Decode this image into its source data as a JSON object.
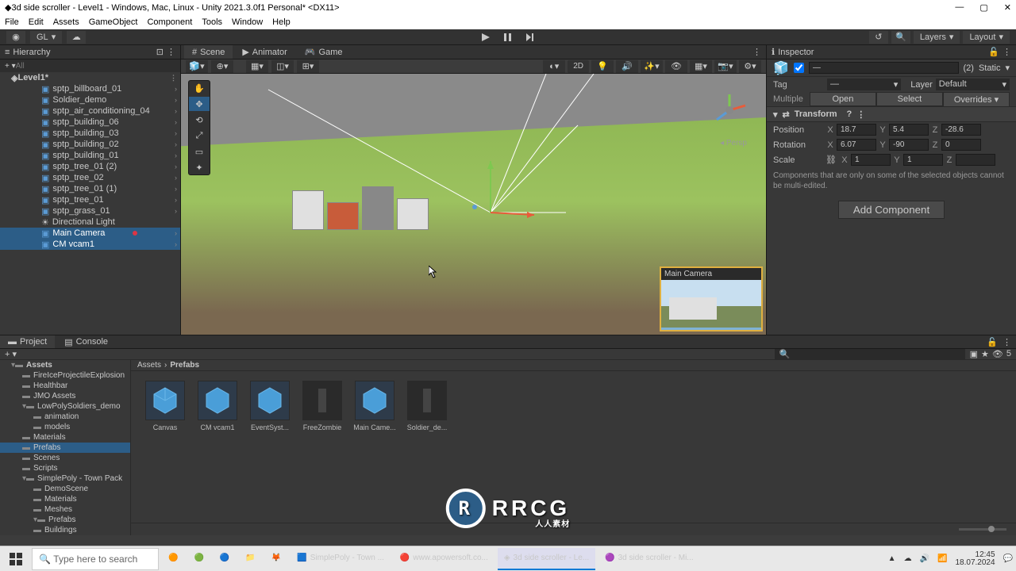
{
  "window": {
    "title": "3d side scroller - Level1 - Windows, Mac, Linux - Unity 2021.3.0f1 Personal* <DX11>",
    "min": "—",
    "max": "▢",
    "close": "✕"
  },
  "menu": [
    "File",
    "Edit",
    "Assets",
    "GameObject",
    "Component",
    "Tools",
    "Window",
    "Help"
  ],
  "toolbar": {
    "gl": "GL",
    "layers": "Layers",
    "layout": "Layout"
  },
  "hierarchy": {
    "title": "Hierarchy",
    "search_placeholder": "All",
    "scene": "Level1*",
    "items": [
      "sptp_billboard_01",
      "Soldier_demo",
      "sptp_air_conditioning_04",
      "sptp_building_06",
      "sptp_building_03",
      "sptp_building_02",
      "sptp_building_01",
      "sptp_tree_01 (2)",
      "sptp_tree_02",
      "sptp_tree_01 (1)",
      "sptp_tree_01",
      "sptp_grass_01",
      "Directional Light",
      "Main Camera",
      "CM vcam1"
    ],
    "selected_indices": [
      13,
      14
    ],
    "red_dot_index": 13
  },
  "scene_tabs": {
    "scene": "Scene",
    "animator": "Animator",
    "game": "Game"
  },
  "scene_toolbar": {
    "mode_2d": "2D",
    "persp": "Persp"
  },
  "camera_preview": {
    "label": "Main Camera"
  },
  "inspector": {
    "title": "Inspector",
    "count": "(2)",
    "static": "Static",
    "tag_label": "Tag",
    "tag_value": "—",
    "layer_label": "Layer",
    "layer_value": "Default",
    "multiple": "Multiple",
    "open": "Open",
    "select": "Select",
    "overrides": "Overrides",
    "transform": "Transform",
    "position": "Position",
    "rotation": "Rotation",
    "scale": "Scale",
    "pos": {
      "x": "18.7",
      "y": "5.4",
      "z": "-28.6"
    },
    "rot": {
      "x": "6.07",
      "y": "-90",
      "z": "0"
    },
    "scl": {
      "x": "1",
      "y": "1",
      "z": ""
    },
    "multi_info": "Components that are only on some of the selected objects cannot be multi-edited.",
    "add_component": "Add Component"
  },
  "project": {
    "project_tab": "Project",
    "console_tab": "Console",
    "tree": [
      {
        "label": "Assets",
        "level": 0,
        "expanded": true
      },
      {
        "label": "FireIceProjectileExplosion",
        "level": 1
      },
      {
        "label": "Healthbar",
        "level": 1
      },
      {
        "label": "JMO Assets",
        "level": 1
      },
      {
        "label": "LowPolySoldiers_demo",
        "level": 1,
        "expanded": true
      },
      {
        "label": "animation",
        "level": 2
      },
      {
        "label": "models",
        "level": 2
      },
      {
        "label": "Materials",
        "level": 1
      },
      {
        "label": "Prefabs",
        "level": 1,
        "selected": true
      },
      {
        "label": "Scenes",
        "level": 1
      },
      {
        "label": "Scripts",
        "level": 1
      },
      {
        "label": "SimplePoly - Town Pack",
        "level": 1,
        "expanded": true
      },
      {
        "label": "DemoScene",
        "level": 2
      },
      {
        "label": "Materials",
        "level": 2
      },
      {
        "label": "Meshes",
        "level": 2
      },
      {
        "label": "Prefabs",
        "level": 2,
        "expanded": true
      },
      {
        "label": "Buildings",
        "level": 2
      }
    ],
    "breadcrumb": [
      "Assets",
      "Prefabs"
    ],
    "items": [
      {
        "name": "Canvas",
        "type": "prefab"
      },
      {
        "name": "CM vcam1",
        "type": "prefab"
      },
      {
        "name": "EventSyst...",
        "type": "prefab"
      },
      {
        "name": "FreeZombie",
        "type": "dark"
      },
      {
        "name": "Main Came...",
        "type": "prefab"
      },
      {
        "name": "Soldier_de...",
        "type": "dark"
      }
    ],
    "footer_count": "5"
  },
  "taskbar": {
    "search_placeholder": "Type here to search",
    "items": [
      {
        "label": "SimplePoly - Town ..."
      },
      {
        "label": "www.apowersoft.co..."
      },
      {
        "label": "3d side scroller - Le...",
        "active": true
      },
      {
        "label": "3d side scroller - Mi..."
      }
    ],
    "time": "12:45",
    "date": "18.07.2024"
  },
  "watermark": {
    "text": "RRCG",
    "sub": "人人素材"
  }
}
